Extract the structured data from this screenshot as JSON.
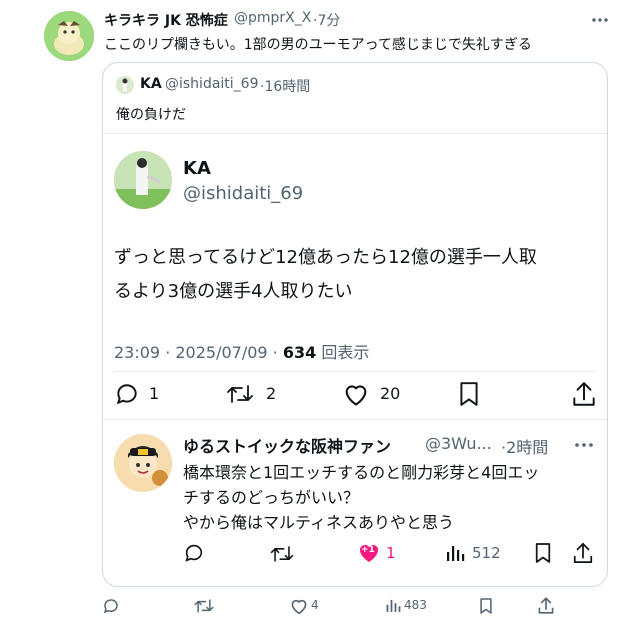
{
  "main_tweet": {
    "display_name": "キラキラ JK 恐怖症",
    "handle": "@pmprX_X",
    "time": "·7分",
    "text": "ここのリプ欄きもい。1部の男のユーモアって感じまじで失礼すぎる",
    "actions": {
      "likes": "4",
      "views": "483"
    }
  },
  "quoted": {
    "display_name": "KA",
    "handle": "@ishidaiti_69",
    "time": "·16時間",
    "text": "俺の負けだ"
  },
  "embedded_tweet": {
    "display_name": "KA",
    "handle": "@ishidaiti_69",
    "text_line1": "ずっと思ってるけど12億あったら12億の選手一人取",
    "text_line2": "るより3億の選手4人取りたい",
    "timestamp": "23:09 · 2025/07/09 · ",
    "views_count": "634",
    "views_label": " 回表示",
    "actions": {
      "replies": "1",
      "retweets": "2",
      "likes": "20"
    }
  },
  "reply": {
    "display_name": "ゆるストイックな阪神ファン",
    "handle": "@3Wu...",
    "time": "·2時間",
    "line1": "橋本環奈と1回エッチするのと剛力彩芽と4回エッ",
    "line2": "チするのどっちがいい？",
    "line3": "やから俺はマルティネスありやと思う",
    "badge": "+1",
    "actions": {
      "likes": "1",
      "views": "512"
    }
  },
  "colors": {
    "text": "#0f1419",
    "muted": "#536471",
    "border": "#cfd9de",
    "like_pink": "#f91880"
  },
  "icons": [
    "more-icon",
    "reply-icon",
    "retweet-icon",
    "like-icon",
    "bookmark-icon",
    "share-icon",
    "views-icon"
  ]
}
